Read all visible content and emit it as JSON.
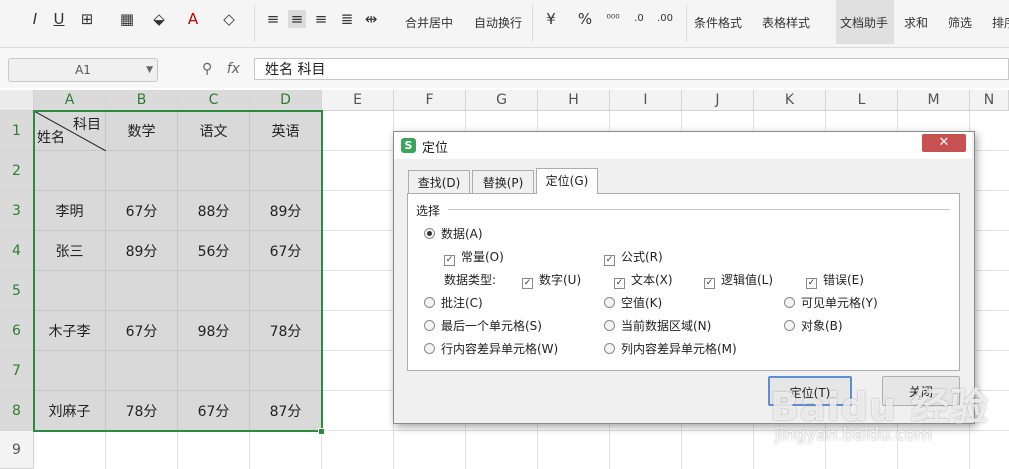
{
  "ribbon": {
    "merge_center": "合并居中",
    "auto_wrap": "自动换行",
    "cond_format": "条件格式",
    "table_style": "表格样式",
    "doc_helper": "文档助手",
    "sum": "求和",
    "filter": "筛选",
    "sort": "排序"
  },
  "formula_bar": {
    "name_box": "A1",
    "fx": "fx",
    "content": "姓名  科目"
  },
  "sheet": {
    "columns": [
      "A",
      "B",
      "C",
      "D",
      "E",
      "F",
      "G",
      "H",
      "I",
      "J",
      "K",
      "L",
      "M",
      "N"
    ],
    "rows": [
      "1",
      "2",
      "3",
      "4",
      "5",
      "6",
      "7",
      "8",
      "9"
    ],
    "header_subject": "科目",
    "header_name": "姓名",
    "header_math": "数学",
    "header_chinese": "语文",
    "header_english": "英语",
    "data": [
      {
        "row": "3",
        "name": "李明",
        "math": "67分",
        "chinese": "88分",
        "english": "89分"
      },
      {
        "row": "4",
        "name": "张三",
        "math": "89分",
        "chinese": "56分",
        "english": "67分"
      },
      {
        "row": "6",
        "name": "木子李",
        "math": "67分",
        "chinese": "98分",
        "english": "78分"
      },
      {
        "row": "8",
        "name": "刘麻子",
        "math": "78分",
        "chinese": "67分",
        "english": "87分"
      }
    ]
  },
  "dialog": {
    "title": "定位",
    "close": "✕",
    "tabs": [
      "查找(D)",
      "替换(P)",
      "定位(G)"
    ],
    "group_label": "选择",
    "opt_data": "数据(A)",
    "opt_constant": "常量(O)",
    "opt_formula": "公式(R)",
    "data_type_label": "数据类型:",
    "opt_number": "数字(U)",
    "opt_text": "文本(X)",
    "opt_logical": "逻辑值(L)",
    "opt_error": "错误(E)",
    "opt_comment": "批注(C)",
    "opt_blank": "空值(K)",
    "opt_visible": "可见单元格(Y)",
    "opt_last_cell": "最后一个单元格(S)",
    "opt_current_region": "当前数据区域(N)",
    "opt_object": "对象(B)",
    "opt_row_diff": "行内容差异单元格(W)",
    "opt_col_diff": "列内容差异单元格(M)",
    "btn_locate": "定位(T)",
    "btn_close": "关闭"
  },
  "watermark": {
    "brand": "Baidu 经验",
    "url": "jingyan.baidu.com"
  }
}
